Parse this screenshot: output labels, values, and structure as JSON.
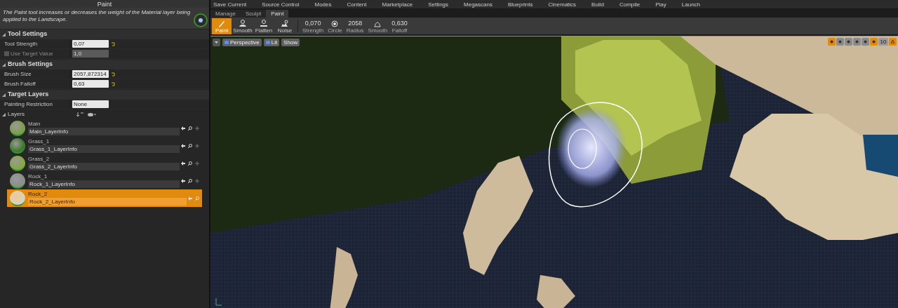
{
  "main_toolbar": {
    "buttons": [
      "Save Current",
      "Source Control",
      "Modes",
      "Content",
      "Marketplace",
      "Settings",
      "Megascans",
      "Blueprints",
      "Cinematics",
      "Build",
      "Compile",
      "Play",
      "Launch"
    ]
  },
  "details_panel": {
    "title": "Paint",
    "description": "The Paint tool increases or decreases the weight of the Material layer being applied to the Landscape.",
    "sections": [
      {
        "title": "Tool Settings",
        "expanded": true,
        "rows": [
          {
            "kind": "spin",
            "label": "Tool Strength",
            "value": "0,07",
            "disabled": false
          },
          {
            "kind": "check",
            "label": "Use Target Value",
            "value": "1,0",
            "checked": false,
            "disabled": true
          }
        ]
      },
      {
        "title": "Brush Settings",
        "expanded": true,
        "rows": [
          {
            "kind": "spin",
            "label": "Brush Size",
            "value": "2057,872314",
            "disabled": false
          },
          {
            "kind": "spin",
            "label": "Brush Falloff",
            "value": "0,63",
            "disabled": false
          }
        ]
      },
      {
        "title": "Target Layers",
        "expanded": true,
        "rows": [
          {
            "kind": "combo",
            "label": "Painting Restriction",
            "value": "None",
            "disabled": false
          }
        ]
      }
    ],
    "layers": {
      "label": "Layers",
      "expanded": true,
      "items": [
        {
          "name": "Main",
          "info": "Main_LayerInfo",
          "color": "#7f9e4a",
          "selected": false
        },
        {
          "name": "Grass_1",
          "info": "Grass_1_LayerInfo",
          "color": "#3f7a2c",
          "selected": false
        },
        {
          "name": "Grass_2",
          "info": "Grass_2_LayerInfo",
          "color": "#86a843",
          "selected": false
        },
        {
          "name": "Rock_1",
          "info": "Rock_1_LayerInfo",
          "color": "#8a8f8a",
          "selected": false
        },
        {
          "name": "Rock_2",
          "info": "Rock_2_LayerInfo",
          "color": "#d8d2bf",
          "selected": true
        }
      ]
    }
  },
  "mode_tabs": [
    {
      "label": "Manage",
      "selected": false
    },
    {
      "label": "Sculpt",
      "selected": false
    },
    {
      "label": "Paint",
      "selected": true
    }
  ],
  "tools": [
    {
      "label": "Paint",
      "selected": true
    },
    {
      "label": "Smooth",
      "selected": false
    },
    {
      "label": "Flatten",
      "selected": false
    },
    {
      "label": "Noise",
      "selected": false
    }
  ],
  "brush_options": [
    {
      "kind": "value",
      "value": "0,070",
      "label": "Strength"
    },
    {
      "kind": "circle",
      "label": "Circle"
    },
    {
      "kind": "value",
      "value": "2058",
      "label": "Radius"
    },
    {
      "kind": "falloff",
      "label": "Smooth"
    },
    {
      "kind": "value",
      "value": "0,630",
      "label": "Falloff"
    }
  ],
  "viewport": {
    "buttons": [
      "Perspective",
      "Lit",
      "Show"
    ],
    "grid_size": "10"
  }
}
